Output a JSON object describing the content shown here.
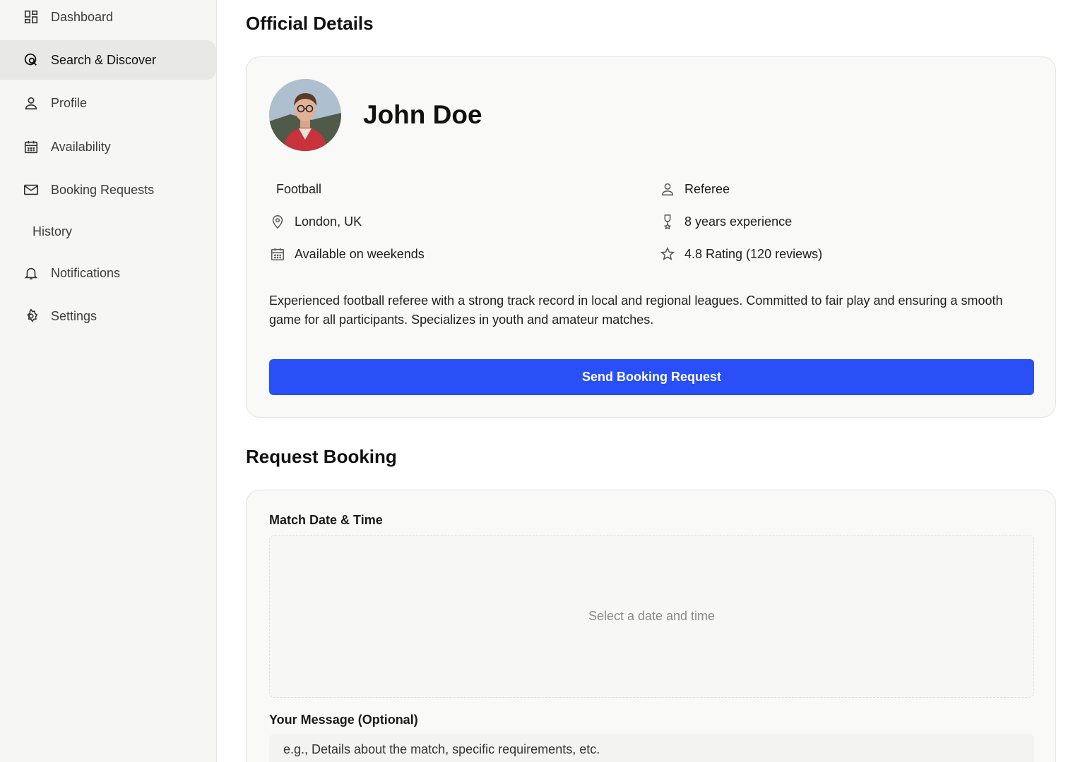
{
  "sidebar": {
    "items": [
      {
        "label": "Dashboard",
        "icon": "dashboard-icon"
      },
      {
        "label": "Search & Discover",
        "icon": "search-discover-icon",
        "active": true
      },
      {
        "label": "Profile",
        "icon": "user-icon"
      },
      {
        "label": "Availability",
        "icon": "calendar-icon"
      },
      {
        "label": "Booking Requests",
        "icon": "mail-icon"
      },
      {
        "label": "History",
        "icon": ""
      },
      {
        "label": "Notifications",
        "icon": "bell-icon"
      },
      {
        "label": "Settings",
        "icon": "gear-icon"
      }
    ]
  },
  "official": {
    "section_title": "Official Details",
    "name": "John Doe",
    "sport": "Football",
    "role": "Referee",
    "location": "London, UK",
    "experience": "8 years experience",
    "availability": "Available on weekends",
    "rating": "4.8 Rating (120 reviews)",
    "bio": "Experienced football referee with a strong track record in local and regional leagues. Committed to fair play and ensuring a smooth game for all participants. Specializes in youth and amateur matches.",
    "button_label": "Send Booking Request"
  },
  "booking": {
    "section_title": "Request Booking",
    "date_label": "Match Date & Time",
    "date_placeholder": "Select a date and time",
    "message_label": "Your Message (Optional)",
    "message_placeholder": "e.g., Details about the match, specific requirements, etc."
  },
  "colors": {
    "accent": "#2850f6",
    "sidebar_bg": "#f6f6f5",
    "active_item_bg": "#e8e8e6"
  }
}
